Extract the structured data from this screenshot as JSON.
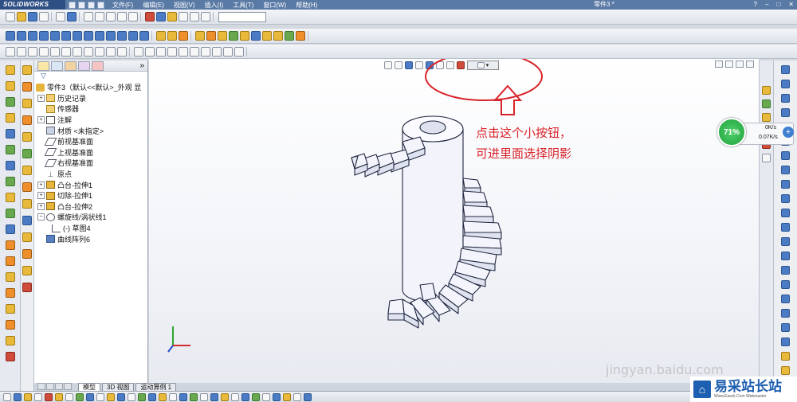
{
  "app": {
    "logo_text": "SOLIDWORKS",
    "document_title": "零件3 *",
    "menus": [
      "文件(F)",
      "编辑(E)",
      "视图(V)",
      "插入(I)",
      "工具(T)",
      "窗口(W)",
      "帮助(H)"
    ]
  },
  "feature_tree": {
    "filter_icon": "filter-icon",
    "root": "零件3（默认<<默认>_外观 显",
    "items": [
      {
        "label": "历史记录",
        "icon": "history-icon",
        "expandable": true,
        "level": 1
      },
      {
        "label": "传感器",
        "icon": "sensor-icon",
        "expandable": false,
        "level": 1
      },
      {
        "label": "注解",
        "icon": "annotation-icon",
        "expandable": true,
        "level": 1
      },
      {
        "label": "材质 <未指定>",
        "icon": "material-icon",
        "expandable": false,
        "level": 1
      },
      {
        "label": "前视基准面",
        "icon": "plane-icon",
        "expandable": false,
        "level": 1
      },
      {
        "label": "上视基准面",
        "icon": "plane-icon",
        "expandable": false,
        "level": 1
      },
      {
        "label": "右视基准面",
        "icon": "plane-icon",
        "expandable": false,
        "level": 1
      },
      {
        "label": "原点",
        "icon": "origin-icon",
        "expandable": false,
        "level": 1
      },
      {
        "label": "凸台-拉伸1",
        "icon": "extrude-boss-icon",
        "expandable": true,
        "level": 1
      },
      {
        "label": "切除-拉伸1",
        "icon": "extrude-cut-icon",
        "expandable": true,
        "level": 1
      },
      {
        "label": "凸台-拉伸2",
        "icon": "extrude-boss-icon",
        "expandable": true,
        "level": 1
      },
      {
        "label": "螺旋线/涡状线1",
        "icon": "helix-icon",
        "expandable": true,
        "level": 1
      },
      {
        "label": "(-) 草图4",
        "icon": "sketch-icon",
        "expandable": false,
        "level": 2
      },
      {
        "label": "曲线阵列6",
        "icon": "curve-pattern-icon",
        "expandable": false,
        "level": 1
      }
    ]
  },
  "bottom_tabs": [
    "模型",
    "3D 视图",
    "运动算例 1"
  ],
  "annotation": {
    "line1": "点击这个小按钮，",
    "line2": "可进里面选择阴影"
  },
  "network": {
    "percent": "71%",
    "upload": "0K/s",
    "download": "0.07K/s"
  },
  "watermark": "jingyan.baidu.com",
  "site_logo": {
    "cn": "易采站长站",
    "en": "Www.Easck.Com Webmaster"
  },
  "colors": {
    "annotation_red": "#d9232a",
    "gauge_green": "#2ab545",
    "logo_blue": "#1d5fb0"
  }
}
